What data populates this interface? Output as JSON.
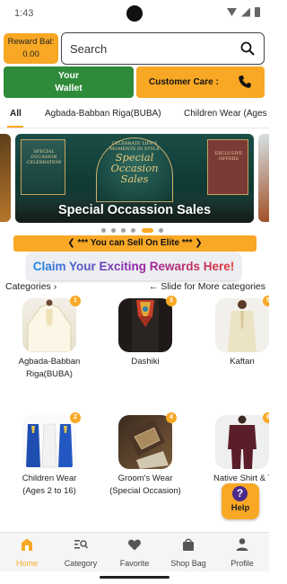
{
  "status": {
    "time": "1:43"
  },
  "reward": {
    "label": "Reward Bal:",
    "value": "0.00"
  },
  "search": {
    "placeholder": "Search"
  },
  "wallet": {
    "line1": "Your",
    "line2": "Wallet"
  },
  "care": {
    "label": "Customer Care :"
  },
  "tabs": [
    "All",
    "Agbada-Babban Riga(BUBA)",
    "Children Wear (Ages"
  ],
  "banner": {
    "caption": "Special Occassion Sales",
    "left_panel": "SPECIAL OCCASION CELEBRATION",
    "tagline": "CELEBRATE LIFE'S MOMENTS IN STYLE",
    "headline": "Special Occasion Sales",
    "right_panel": "EXCLUSIVE OFFERS"
  },
  "elite_banner": "*** You can Sell On Elite ***",
  "rewards_banner": "Claim Your Exciting Rewards Here!",
  "categories_header": "Categories",
  "slide_hint": "Slide for More categories",
  "categories": [
    {
      "name": "Agbada-Babban Riga(BUBA)",
      "badge": "1"
    },
    {
      "name": "Dashiki",
      "badge": "3"
    },
    {
      "name": "Kaftan",
      "badge": "5"
    },
    {
      "name": "Children Wear (Ages 2 to 16)",
      "badge": "2"
    },
    {
      "name": "Groom's Wear (Special Occasion)",
      "badge": "4"
    },
    {
      "name": "Native Shirt & Trousers (Bub",
      "badge": "6"
    }
  ],
  "help": {
    "label": "Help",
    "icon_glyph": "?"
  },
  "nav": [
    "Home",
    "Category",
    "Favorite",
    "Shop Bag",
    "Profile"
  ],
  "colors": {
    "accent": "#f9a825",
    "wallet_green": "#2e8b3a",
    "nav_active": "#f9a825"
  },
  "carousel": {
    "count": 6,
    "active_index": 4
  }
}
